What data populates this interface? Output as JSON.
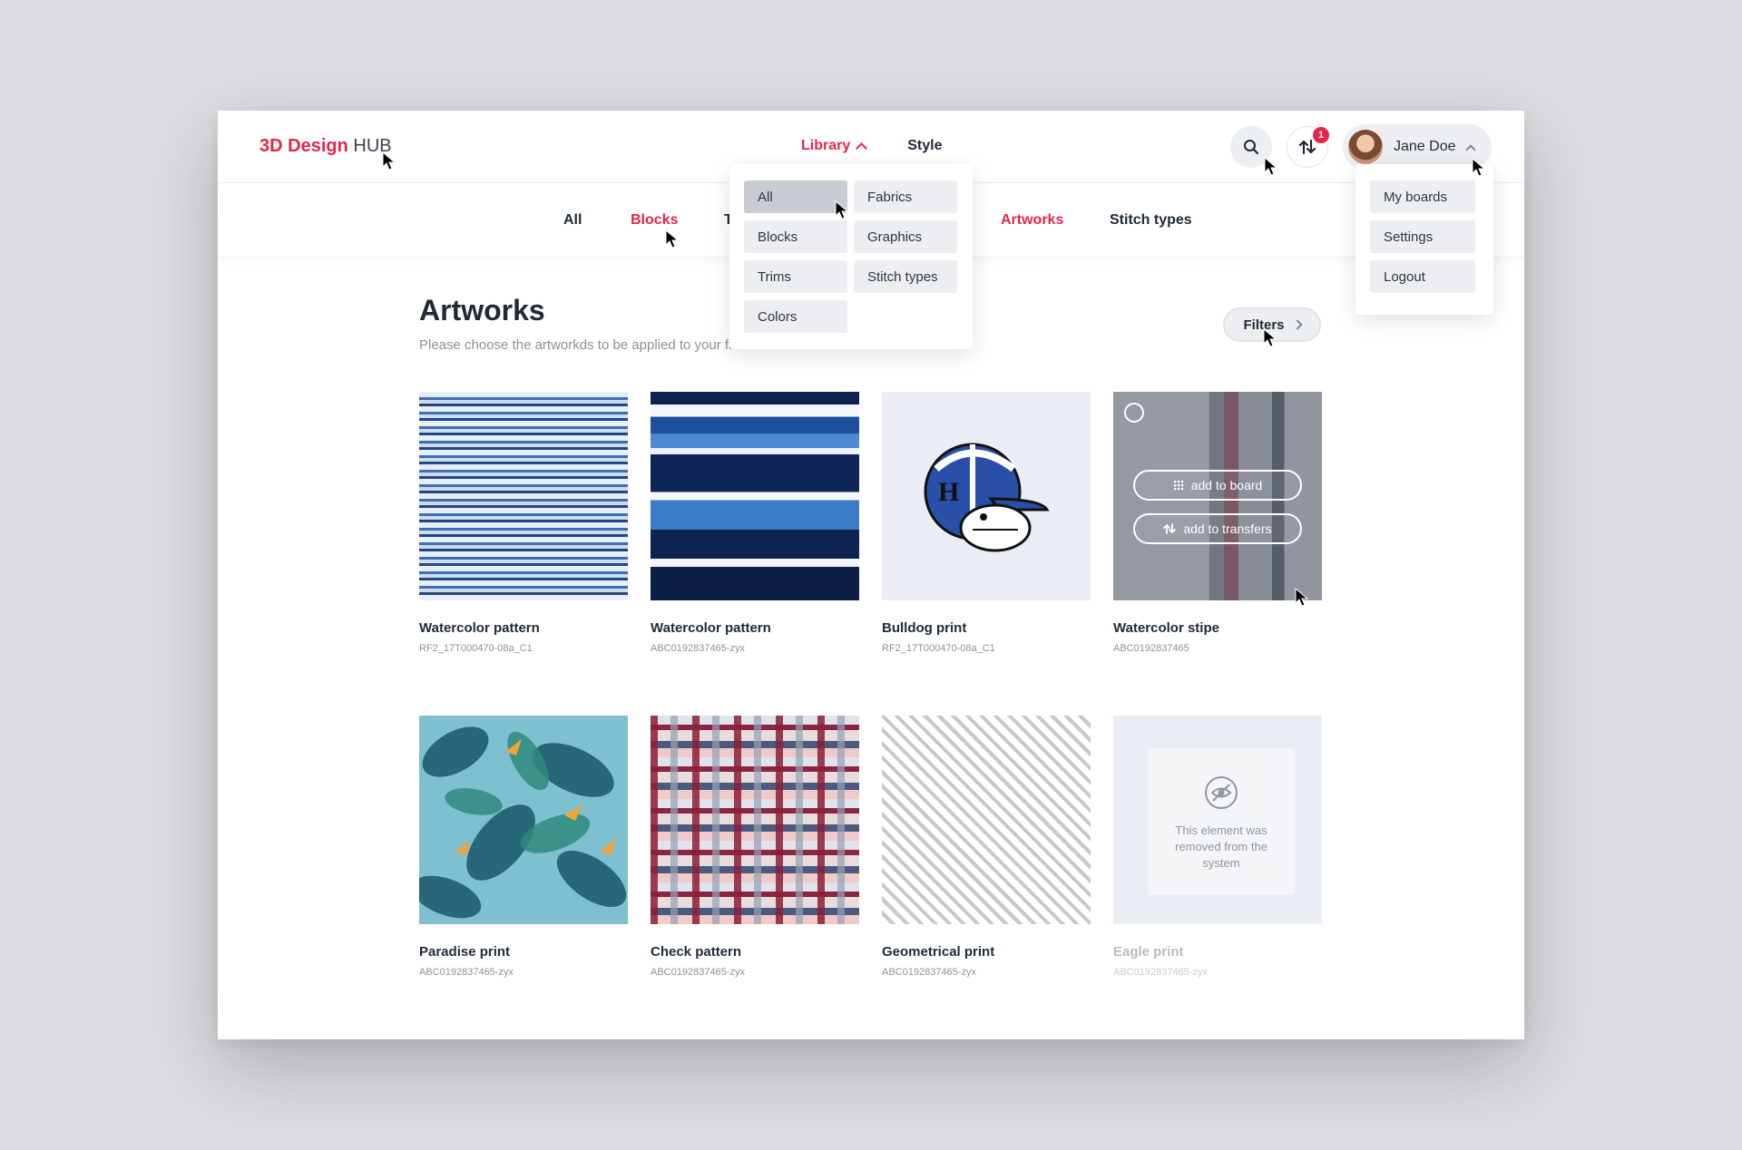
{
  "header": {
    "logo_brand": "3D Design",
    "logo_suffix": "HUB",
    "nav_library": "Library",
    "nav_style": "Style",
    "transfers_badge": "1",
    "user_name": "Jane Doe"
  },
  "subnav": {
    "items": [
      "All",
      "Blocks",
      "T",
      "Artworks",
      "Stitch types"
    ]
  },
  "library_menu": {
    "items": [
      "All",
      "Fabrics",
      "Blocks",
      "Graphics",
      "Trims",
      "Stitch types",
      "Colors"
    ],
    "selected": "All"
  },
  "user_menu": {
    "items": [
      "My boards",
      "Settings",
      "Logout"
    ]
  },
  "page": {
    "title": "Artworks",
    "subtitle": "Please choose the artworkds to be applied to your fabric.",
    "filters_label": "Filters"
  },
  "hover_actions": {
    "add_to_board": "add to board",
    "add_to_transfers": "add to transfers"
  },
  "removed_notice": "This element was removed from the system",
  "artworks": [
    {
      "name": "Watercolor pattern",
      "code": "RF2_17T000470-08a_C1"
    },
    {
      "name": "Watercolor pattern",
      "code": "ABC0192837465-zyx"
    },
    {
      "name": "Bulldog print",
      "code": "RF2_17T000470-08a_C1"
    },
    {
      "name": "Watercolor stipe",
      "code": "ABC0192837465"
    },
    {
      "name": "Paradise print",
      "code": "ABC0192837465-zyx"
    },
    {
      "name": "Check pattern",
      "code": "ABC0192837465-zyx"
    },
    {
      "name": "Geometrical print",
      "code": "ABC0192837465-zyx"
    },
    {
      "name": "Eagle print",
      "code": "ABC0192837465-zyx"
    }
  ],
  "colors": {
    "accent": "#e8244a",
    "text": "#1f2a37",
    "muted": "#8a919c",
    "chip": "#edeef2"
  }
}
